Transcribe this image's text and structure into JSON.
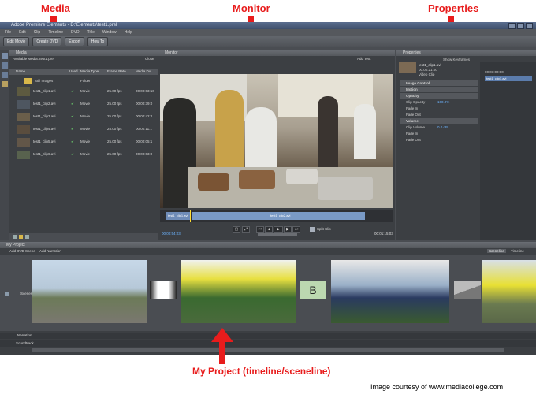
{
  "annotations": {
    "media": "Media",
    "monitor": "Monitor",
    "properties": "Properties",
    "project": "My Project  (timeline/sceneline)",
    "courtesy": "Image courtesy of www.mediacollege.com"
  },
  "window": {
    "title": "Adobe Premiere Elements - D:\\Elements\\test1.prel"
  },
  "menu": [
    "File",
    "Edit",
    "Clip",
    "Timeline",
    "DVD",
    "Title",
    "Window",
    "Help"
  ],
  "toolbar": {
    "edit_movie": "Edit Movie",
    "create_dvd": "Create DVD",
    "export": "Export",
    "how_to": "How To"
  },
  "media_panel": {
    "title": "Media",
    "available": "Available Media: test1.prel",
    "close": "Close",
    "columns": [
      "Name",
      "Used",
      "Media Type",
      "Frame Rate",
      "Media Du"
    ],
    "folder": {
      "name": "Still Images",
      "type": "Folder"
    },
    "rows": [
      {
        "name": "test1_clip1.avi",
        "type": "Movie",
        "fps": "25.00 fps",
        "dur": "00:00:03:16"
      },
      {
        "name": "test1_clip2.avi",
        "type": "Movie",
        "fps": "25.00 fps",
        "dur": "00:00:39:0"
      },
      {
        "name": "test1_clip3.avi",
        "type": "Movie",
        "fps": "25.00 fps",
        "dur": "00:00:42:2"
      },
      {
        "name": "test1_clip4.avi",
        "type": "Movie",
        "fps": "25.00 fps",
        "dur": "00:00:11:1"
      },
      {
        "name": "test1_clip5.avi",
        "type": "Movie",
        "fps": "25.00 fps",
        "dur": "00:00:05:1"
      },
      {
        "name": "test1_clip6.avi",
        "type": "Movie",
        "fps": "25.00 fps",
        "dur": "00:00:03:0"
      }
    ]
  },
  "monitor_panel": {
    "title": "Monitor",
    "add_text": "Add Text",
    "clip_label_1": "test1_clip1.avi",
    "clip_label_2": "test1_clip2.avi",
    "timecode_left": "00:00:54:03",
    "timecode_right": "00:01:15:03",
    "split_clip": "Split Clip"
  },
  "properties_panel": {
    "title": "Properties",
    "clip_name": "test1_clip1.avi",
    "clip_duration": "00:00:21:00",
    "clip_type": "Video Clip",
    "show_keyframes": "Show Keyframes",
    "ruler_time": "00:01:00:00",
    "clip_tag": "test1_clip1.avi",
    "rows": [
      {
        "label": "Image Control",
        "section": true
      },
      {
        "label": "Motion",
        "section": true
      },
      {
        "label": "Opacity",
        "section": true
      },
      {
        "label": "Clip Opacity",
        "value": "100.0%",
        "section": false
      },
      {
        "label": "Fade In",
        "section": false
      },
      {
        "label": "Fade Out",
        "section": false
      },
      {
        "label": "Volume",
        "section": true
      },
      {
        "label": "Clip Volume",
        "value": "0.0 dB",
        "section": false
      },
      {
        "label": "Fade In",
        "section": false
      },
      {
        "label": "Fade Out",
        "section": false
      }
    ]
  },
  "project_panel": {
    "title": "My Project",
    "add_dvd_scene": "Add DVD Scene",
    "add_narration": "Add Narration",
    "sceneline_tab": "Sceneline",
    "timeline_tab": "Timeline",
    "track_scenes": "Scenes",
    "track_narration": "Narration",
    "track_soundtrack": "Soundtrack",
    "transition_b": "B"
  },
  "colors": {
    "arrow_red": "#e81c1c",
    "panel_bg": "#3c3f43",
    "app_bg": "#4a4d52"
  }
}
